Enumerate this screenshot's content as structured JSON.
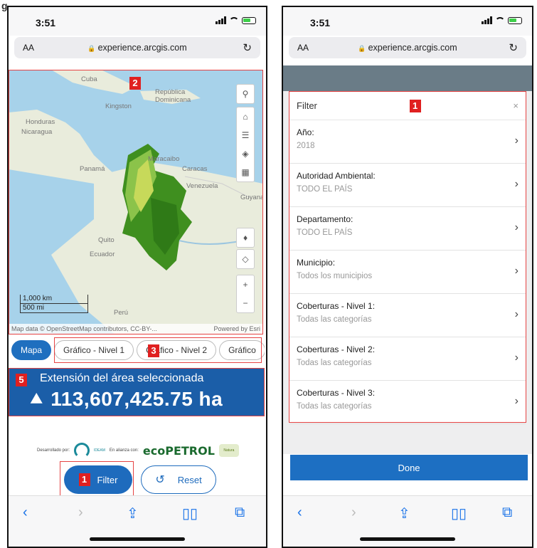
{
  "figure_label": "g",
  "left_phone": {
    "status": {
      "time": "3:51"
    },
    "browser": {
      "aa": "AA",
      "url": "experience.arcgis.com"
    },
    "map": {
      "labels": [
        "Cuba",
        "República Dominicana",
        "Kingston",
        "Honduras",
        "Nicaragua",
        "Panamá",
        "Maracaibo",
        "Caracas",
        "Venezuela",
        "Guyana",
        "Quito",
        "Ecuador",
        "Perú"
      ],
      "scale_km": "1,000 km",
      "scale_mi": "500 mi",
      "attribution_left": "Map data © OpenStreetMap contributors, CC-BY-...",
      "attribution_right": "Powered by Esri"
    },
    "tabs": [
      "Mapa",
      "Gráfico - Nivel 1",
      "Gráfico - Nivel 2",
      "Gráfico"
    ],
    "banner": {
      "title": "Extensión del área seleccionada",
      "value": "113,607,425.75 ha"
    },
    "logos": {
      "developed_by": "Desarrollado por:",
      "ideam": "IDEAM",
      "alliance": "En alianza con:",
      "ecopetrol": "ecoPETROL",
      "natura": "Natura"
    },
    "buttons": {
      "filter": "Filter",
      "reset": "Reset"
    },
    "badges": {
      "map": "2",
      "tabs": "3",
      "banner": "5",
      "filter": "1"
    }
  },
  "right_phone": {
    "status": {
      "time": "3:51"
    },
    "browser": {
      "aa": "AA",
      "url": "experience.arcgis.com"
    },
    "filter_panel": {
      "title": "Filter",
      "close": "×",
      "badge": "1",
      "rows": [
        {
          "label": "Año:",
          "value": "2018"
        },
        {
          "label": "Autoridad Ambiental:",
          "value": "TODO EL PAÍS"
        },
        {
          "label": "Departamento:",
          "value": "TODO EL PAÍS"
        },
        {
          "label": "Municipio:",
          "value": "Todos los municipios"
        },
        {
          "label": "Coberturas - Nivel 1:",
          "value": "Todas las categorías"
        },
        {
          "label": "Coberturas - Nivel 2:",
          "value": "Todas las categorías"
        },
        {
          "label": "Coberturas - Nivel 3:",
          "value": "Todas las categorías"
        }
      ]
    },
    "done": "Done"
  },
  "colors": {
    "accent": "#1e6bbd",
    "highlight": "#e64343",
    "forest": "#3f8f1f"
  },
  "icons": [
    "search-icon",
    "home-icon",
    "layer-list-icon",
    "layers-icon",
    "basemap-gallery-icon",
    "compass-icon",
    "locate-icon",
    "zoom-in-icon",
    "zoom-out-icon",
    "back-icon",
    "forward-icon",
    "share-icon",
    "bookmarks-icon",
    "tabs-icon",
    "reload-icon",
    "lock-icon",
    "tree-icon",
    "reset-icon",
    "chevron-right-icon"
  ]
}
